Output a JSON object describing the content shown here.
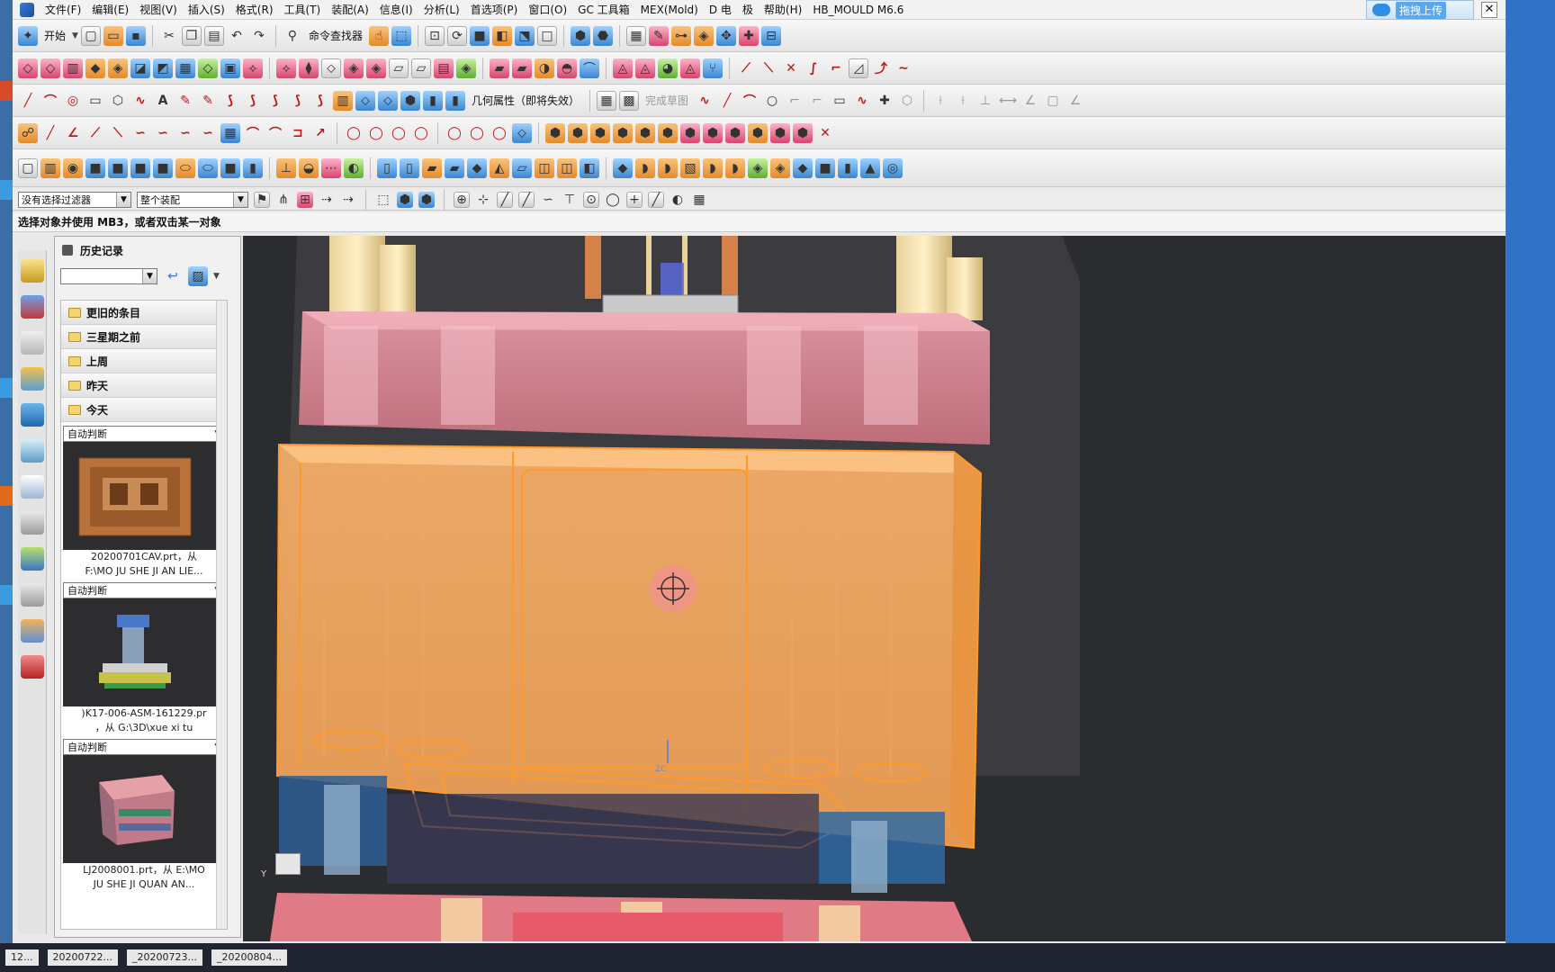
{
  "menubar": {
    "items": [
      "文件(F)",
      "编辑(E)",
      "视图(V)",
      "插入(S)",
      "格式(R)",
      "工具(T)",
      "装配(A)",
      "信息(I)",
      "分析(L)",
      "首选项(P)",
      "窗口(O)",
      "GC 工具箱",
      "MEX(Mold)",
      "D 电",
      "极",
      "帮助(H)",
      "HB_MOULD M6.6"
    ],
    "upload_label": "拖拽上传",
    "close_glyph": "✕"
  },
  "toolbar1": {
    "start_label": "开始",
    "command_finder_label": "命令查找器"
  },
  "toolbar3": {
    "geom_prop_label": "几何属性（即将失效）",
    "finish_sketch_label": "完成草图"
  },
  "selection_bar": {
    "filter_value": "没有选择过滤器",
    "scope_value": "整个装配"
  },
  "status": {
    "message": "选择对象并使用 MB3，或者双击某一对象"
  },
  "history": {
    "title": "历史记录",
    "folders": [
      "更旧的条目",
      "三星期之前",
      "上周",
      "昨天",
      "今天"
    ],
    "entries": [
      {
        "mode": "自动判断",
        "caption1": "20200701CAV.prt，从",
        "caption2": "F:\\MO JU SHE JI AN LIE..."
      },
      {
        "mode": "自动判断",
        "caption1": ")K17-006-ASM-161229.pr",
        "caption2": "，从 G:\\3D\\xue xi tu"
      },
      {
        "mode": "自动判断",
        "caption1": "LJ2008001.prt，从 E:\\MO",
        "caption2": "JU SHE JI QUAN AN..."
      }
    ]
  },
  "taskbar": {
    "tasks": [
      "12...",
      "20200722...",
      "_20200723...",
      "_20200804..."
    ]
  },
  "viewport": {
    "axis_label_y": "Y",
    "axis_label_z": "ZC"
  }
}
